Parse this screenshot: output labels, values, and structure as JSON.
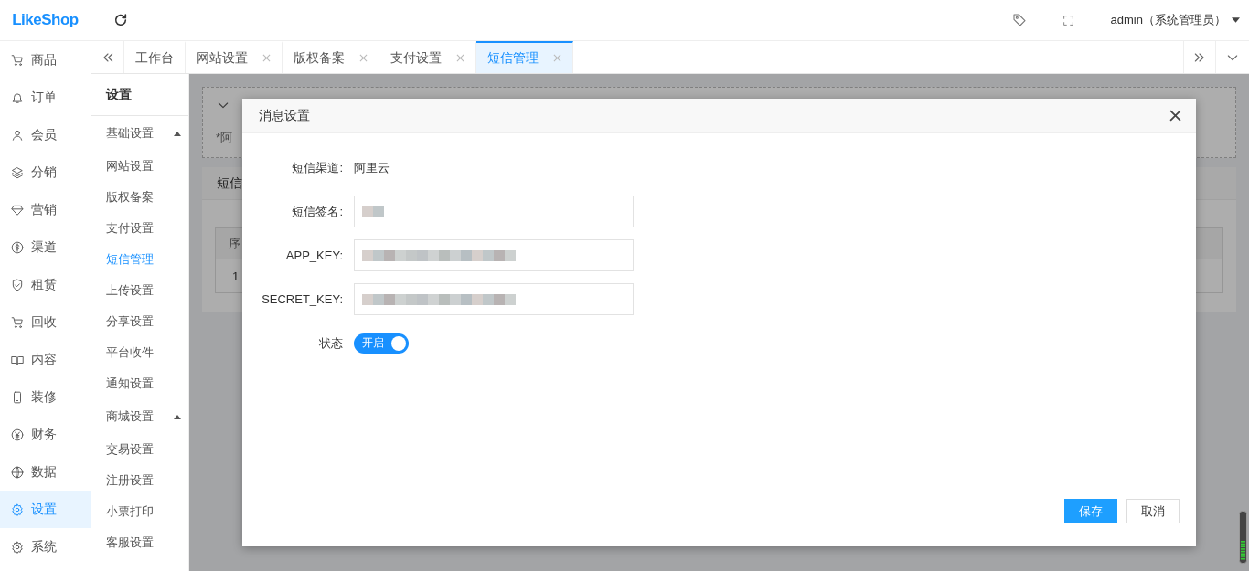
{
  "logo": "LikeShop",
  "header": {
    "user": "admin（系统管理员）"
  },
  "tabs": [
    {
      "label": "工作台",
      "selected": false
    },
    {
      "label": "网站设置",
      "selected": false
    },
    {
      "label": "版权备案",
      "selected": false
    },
    {
      "label": "支付设置",
      "selected": false
    },
    {
      "label": "短信管理",
      "selected": true
    }
  ],
  "sidebar": {
    "items": [
      {
        "label": "商品",
        "selected": false
      },
      {
        "label": "订单",
        "selected": false
      },
      {
        "label": "会员",
        "selected": false
      },
      {
        "label": "分销",
        "selected": false
      },
      {
        "label": "营销",
        "selected": false
      },
      {
        "label": "渠道",
        "selected": false
      },
      {
        "label": "租赁",
        "selected": false
      },
      {
        "label": "回收",
        "selected": false
      },
      {
        "label": "内容",
        "selected": false
      },
      {
        "label": "装修",
        "selected": false
      },
      {
        "label": "财务",
        "selected": false
      },
      {
        "label": "数据",
        "selected": false
      },
      {
        "label": "设置",
        "selected": true
      },
      {
        "label": "系统",
        "selected": false
      }
    ]
  },
  "submenu": {
    "title": "设置",
    "groups": [
      {
        "label": "基础设置",
        "expanded": true,
        "children": [
          {
            "label": "网站设置",
            "selected": false
          },
          {
            "label": "版权备案",
            "selected": false
          },
          {
            "label": "支付设置",
            "selected": false
          },
          {
            "label": "短信管理",
            "selected": true
          },
          {
            "label": "上传设置",
            "selected": false
          },
          {
            "label": "分享设置",
            "selected": false
          },
          {
            "label": "平台收件",
            "selected": false
          },
          {
            "label": "通知设置",
            "selected": false
          }
        ]
      },
      {
        "label": "商城设置",
        "expanded": true,
        "children": [
          {
            "label": "交易设置",
            "selected": false
          },
          {
            "label": "注册设置",
            "selected": false
          },
          {
            "label": "小票打印",
            "selected": false
          },
          {
            "label": "客服设置",
            "selected": false
          }
        ]
      }
    ]
  },
  "background": {
    "notice": "*阿",
    "card_title": "短信",
    "column_1": "序",
    "row_1": "1"
  },
  "dialog": {
    "title": "消息设置",
    "fields": [
      {
        "kind": "text",
        "label": "短信渠道:",
        "value": "阿里云"
      },
      {
        "kind": "input",
        "label": "短信签名:"
      },
      {
        "kind": "input",
        "label": "APP_KEY:"
      },
      {
        "kind": "input",
        "label": "SECRET_KEY:"
      },
      {
        "kind": "switch",
        "label": "状态",
        "on": true,
        "switch_label": "开启"
      }
    ],
    "buttons": [
      "保存",
      "取消"
    ]
  }
}
